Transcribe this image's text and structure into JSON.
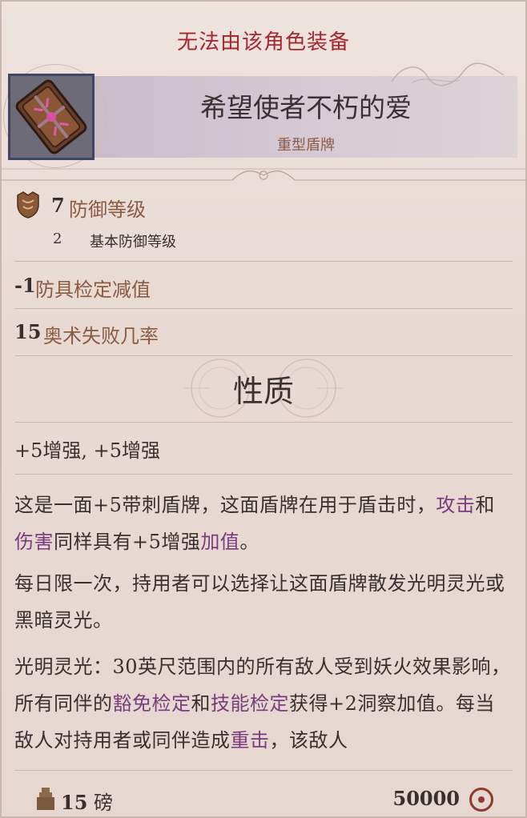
{
  "header": {
    "warning": "无法由该角色装备",
    "title": "希望使者不朽的爱",
    "type": "重型盾牌"
  },
  "stats": {
    "armor_class_value": "7",
    "armor_class_label": "防御等级",
    "base_ac_value": "2",
    "base_ac_label": "基本防御等级",
    "armor_check_value": "-1",
    "armor_check_label": "防具检定减值",
    "arcane_fail_value": "15",
    "arcane_fail_label": "奥术失败几率"
  },
  "properties": {
    "title": "性质",
    "enchantment": "+5增强, +5增强",
    "p1_a": "这是一面+5带刺盾牌，这面盾牌在用于盾击时，",
    "p1_kw1": "攻击",
    "p1_b": "和",
    "p1_kw2": "伤害",
    "p1_c": "同样具有+5增强",
    "p1_kw3": "加值",
    "p1_d": "。",
    "p2": "每日限一次，持用者可以选择让这面盾牌散发光明灵光或黑暗灵光。",
    "p3_a": "光明灵光：30英尺范围内的所有敌人受到妖火效果影响，所有同伴的",
    "p3_kw1": "豁免检定",
    "p3_b": "和",
    "p3_kw2": "技能检定",
    "p3_c": "获得+2洞察加值。每当敌人对持用者或同伴造成",
    "p3_kw3": "重击",
    "p3_d": "，该敌人"
  },
  "footer": {
    "weight_value": "15",
    "weight_unit": "磅",
    "price": "50000"
  },
  "colors": {
    "warning": "#a5282f",
    "keyword": "#7a3b7e",
    "label": "#8a5a42",
    "header_band": "#c9bdca"
  },
  "icons": {
    "item": "spiked-shield-icon",
    "armor": "breastplate-icon",
    "weight": "weight-icon",
    "coin": "coin-icon"
  }
}
